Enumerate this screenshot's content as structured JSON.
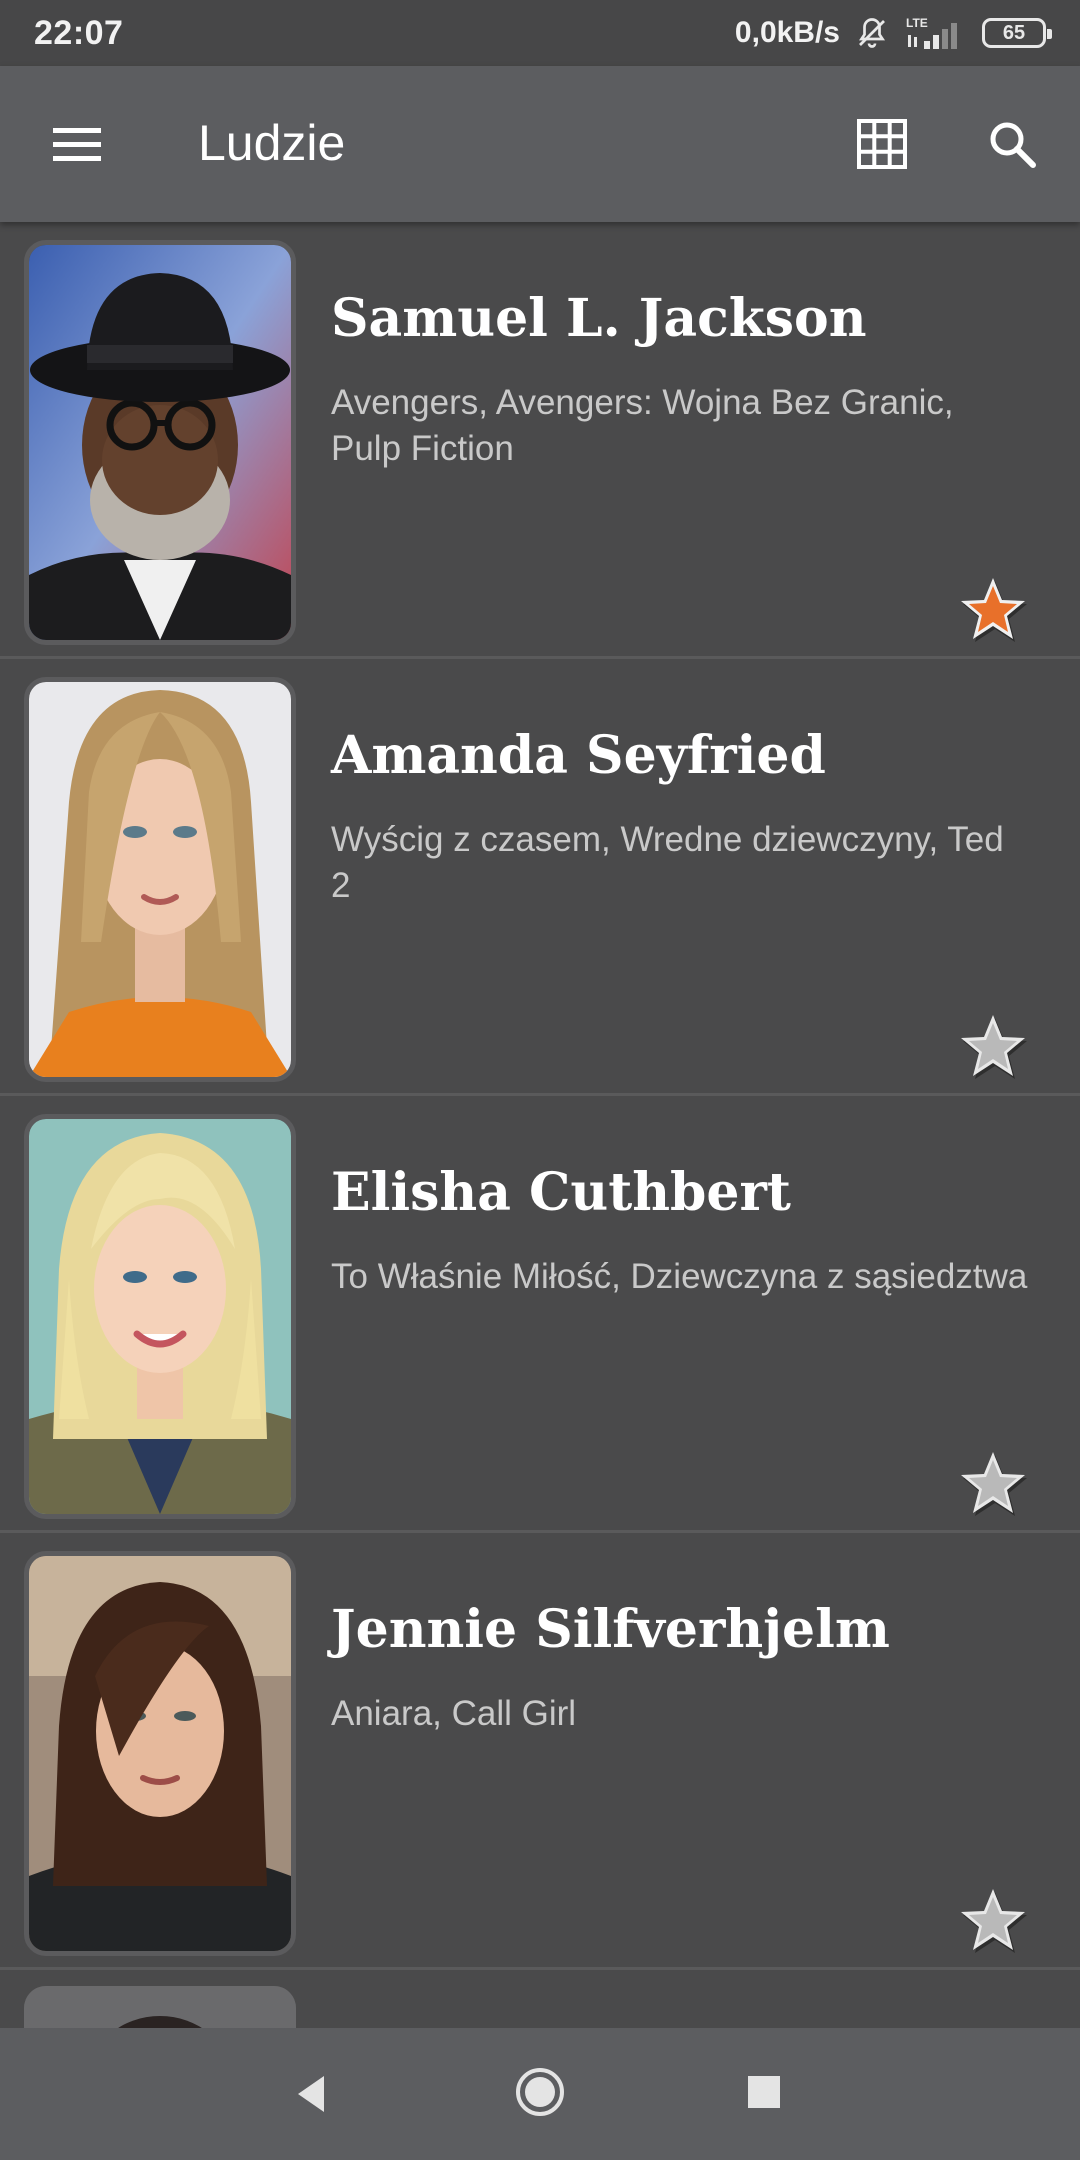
{
  "status_bar": {
    "time": "22:07",
    "network_speed": "0,0kB/s",
    "network_type": "LTE",
    "battery_level": "65",
    "icons": [
      "bell-muted-icon",
      "signal-icon",
      "battery-icon"
    ]
  },
  "toolbar": {
    "title": "Ludzie",
    "menu_icon": "hamburger-menu-icon",
    "grid_icon": "grid-view-icon",
    "search_icon": "search-icon"
  },
  "people": [
    {
      "name": "Samuel L. Jackson",
      "films": "Avengers, Avengers: Wojna Bez Granic, Pulp Fiction",
      "favorite": true
    },
    {
      "name": "Amanda Seyfried",
      "films": "Wyścig z czasem, Wredne dziewczyny, Ted 2",
      "favorite": false
    },
    {
      "name": "Elisha Cuthbert",
      "films": "To Właśnie Miłość, Dziewczyna z sąsiedztwa",
      "favorite": false
    },
    {
      "name": "Jennie Silfverhjelm",
      "films": "Aniara, Call Girl",
      "favorite": false
    }
  ],
  "colors": {
    "background": "#4a4a4b",
    "toolbar": "#5c5d60",
    "star_active": "#e8702a",
    "star_inactive": "#b9b9b9"
  },
  "nav_bar": {
    "icons": [
      "back-icon",
      "home-icon",
      "recents-icon"
    ]
  }
}
